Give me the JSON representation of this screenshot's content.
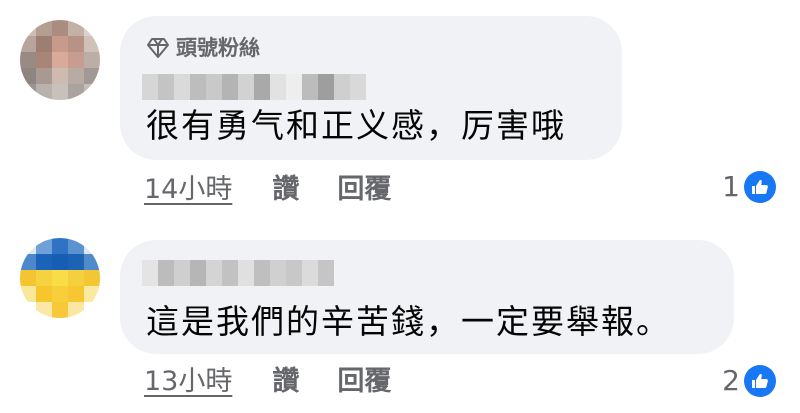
{
  "colors": {
    "bubble": "#f0f2f5",
    "secondary_text": "#65676b",
    "like_blue": "#1877f2"
  },
  "comments": [
    {
      "badge_label": "頭號粉絲",
      "badge_icon": "diamond-icon",
      "text": "很有勇气和正义感，厉害哦",
      "timestamp": "14小時",
      "like_label": "讚",
      "reply_label": "回覆",
      "reaction_count": "1"
    },
    {
      "text": "這是我們的辛苦錢，一定要舉報。",
      "timestamp": "13小時",
      "like_label": "讚",
      "reply_label": "回覆",
      "reaction_count": "2"
    }
  ]
}
